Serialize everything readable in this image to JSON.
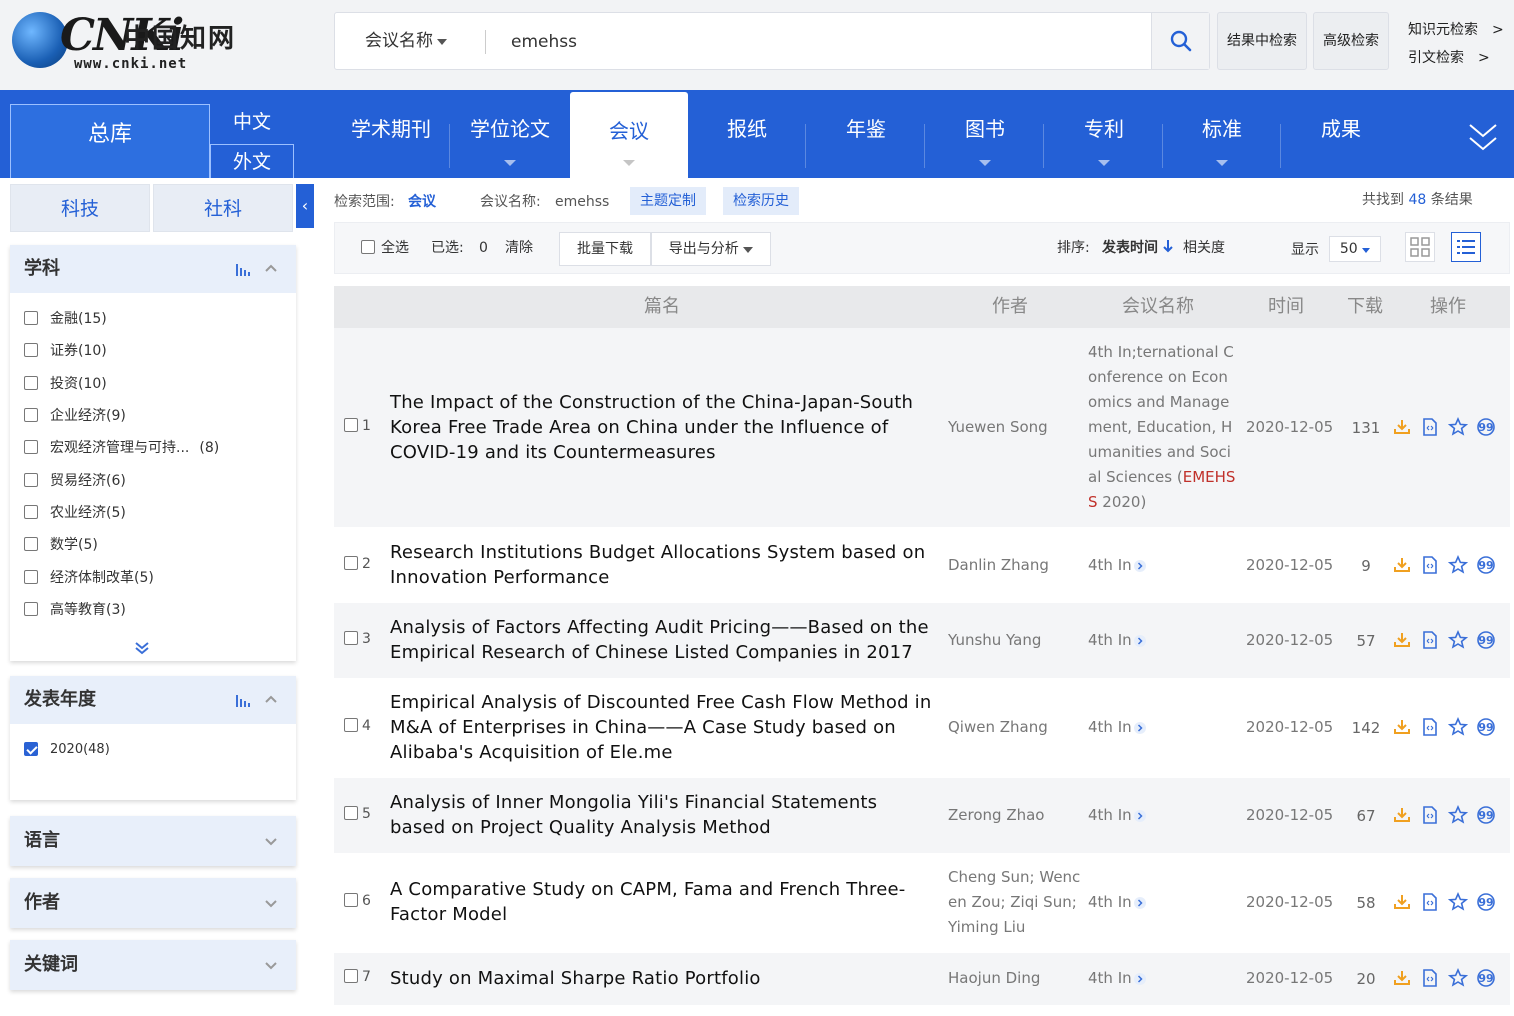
{
  "logo": {
    "cn_text": "中国知网",
    "url_text": "www.cnki.net",
    "mark": "CNKi"
  },
  "search": {
    "field": "会议名称",
    "value": "emehss",
    "placeholder": ""
  },
  "header_buttons": {
    "in_results": "结果中检索",
    "advanced": "高级检索"
  },
  "header_links": {
    "knowledge": "知识元检索",
    "citation": "引文检索",
    "arrow": ">"
  },
  "nav": {
    "all": "总库",
    "chinese": "中文",
    "foreign": "外文",
    "tabs": [
      "学术期刊",
      "学位论文",
      "会议",
      "报纸",
      "年鉴",
      "图书",
      "专利",
      "标准",
      "成果"
    ],
    "active_tab": "会议"
  },
  "sidebar": {
    "cat_tabs": [
      "科技",
      "社科"
    ],
    "collapse_glyph": "‹",
    "subject": {
      "title": "学科",
      "items": [
        {
          "label": "金融(15)"
        },
        {
          "label": "证券(10)"
        },
        {
          "label": "投资(10)"
        },
        {
          "label": "企业经济(9)"
        },
        {
          "label": "宏观经济管理与可持...",
          "count": "(8)"
        },
        {
          "label": "贸易经济(6)"
        },
        {
          "label": "农业经济(5)"
        },
        {
          "label": "数学(5)"
        },
        {
          "label": "经济体制改革(5)"
        },
        {
          "label": "高等教育(3)"
        }
      ]
    },
    "year": {
      "title": "发表年度",
      "items": [
        {
          "label": "2020(48)",
          "checked": true
        }
      ]
    },
    "language": "语言",
    "author": "作者",
    "keyword": "关键词"
  },
  "crumbs": {
    "scope_label": "检索范围:",
    "scope_value": "会议",
    "query_label": "会议名称:",
    "query_value": "emehss",
    "topic_btn": "主题定制",
    "history_btn": "检索历史",
    "found_prefix": "共找到",
    "found_count": "48",
    "found_suffix": "条结果"
  },
  "toolbar": {
    "select_all": "全选",
    "selected_label": "已选:",
    "selected_count": "0",
    "clear": "清除",
    "batch_download": "批量下载",
    "export": "导出与分析",
    "sort_label": "排序:",
    "sort_by_time": "发表时间",
    "sort_relevance": "相关度",
    "display_label": "显示",
    "page_size": "50"
  },
  "table": {
    "headers": {
      "title": "篇名",
      "author": "作者",
      "conference": "会议名称",
      "date": "时间",
      "downloads": "下载",
      "actions": "操作"
    },
    "conf_full_before": "4th In;ternational Conference on Economics and Management, Education, Humanities and Social Sciences (",
    "conf_full_red": "EMEHSS",
    "conf_full_after": " 2020)",
    "conf_short": "4th In",
    "rows": [
      {
        "num": "1",
        "title": "The Impact of the Construction of the China-Japan-South Korea Free Trade Area on China under the Influence of COVID-19 and its Countermeasures",
        "author": "Yuewen Song",
        "date": "2020-12-05",
        "downloads": "131"
      },
      {
        "num": "2",
        "title": "Research Institutions Budget Allocations System based on Innovation Performance",
        "author": "Danlin Zhang",
        "date": "2020-12-05",
        "downloads": "9"
      },
      {
        "num": "3",
        "title": "Analysis of Factors Affecting Audit Pricing——Based on the Empirical Research of Chinese Listed Companies in 2017",
        "author": "Yunshu Yang",
        "date": "2020-12-05",
        "downloads": "57"
      },
      {
        "num": "4",
        "title": "Empirical Analysis of Discounted Free Cash Flow Method in M&A of Enterprises in China——A Case Study based on Alibaba's Acquisition of Ele.me",
        "author": "Qiwen Zhang",
        "date": "2020-12-05",
        "downloads": "142"
      },
      {
        "num": "5",
        "title": "Analysis of Inner Mongolia Yili's Financial Statements based on Project Quality Analysis Method",
        "author": "Zerong Zhao",
        "date": "2020-12-05",
        "downloads": "67"
      },
      {
        "num": "6",
        "title": "A Comparative Study on CAPM, Fama and French Three-Factor Model",
        "author": "Cheng Sun; Wencen Zou; Ziqi Sun; Yiming Liu",
        "date": "2020-12-05",
        "downloads": "58"
      },
      {
        "num": "7",
        "title": "Study on Maximal Sharpe Ratio Portfolio",
        "author": "Haojun Ding",
        "date": "2020-12-05",
        "downloads": "20"
      }
    ]
  },
  "colors": {
    "nav_blue": "#2460d6",
    "panel_bg": "#e8effa",
    "accent_orange": "#f0a020",
    "link_blue": "#2460d6",
    "emph_red": "#c0302a"
  }
}
